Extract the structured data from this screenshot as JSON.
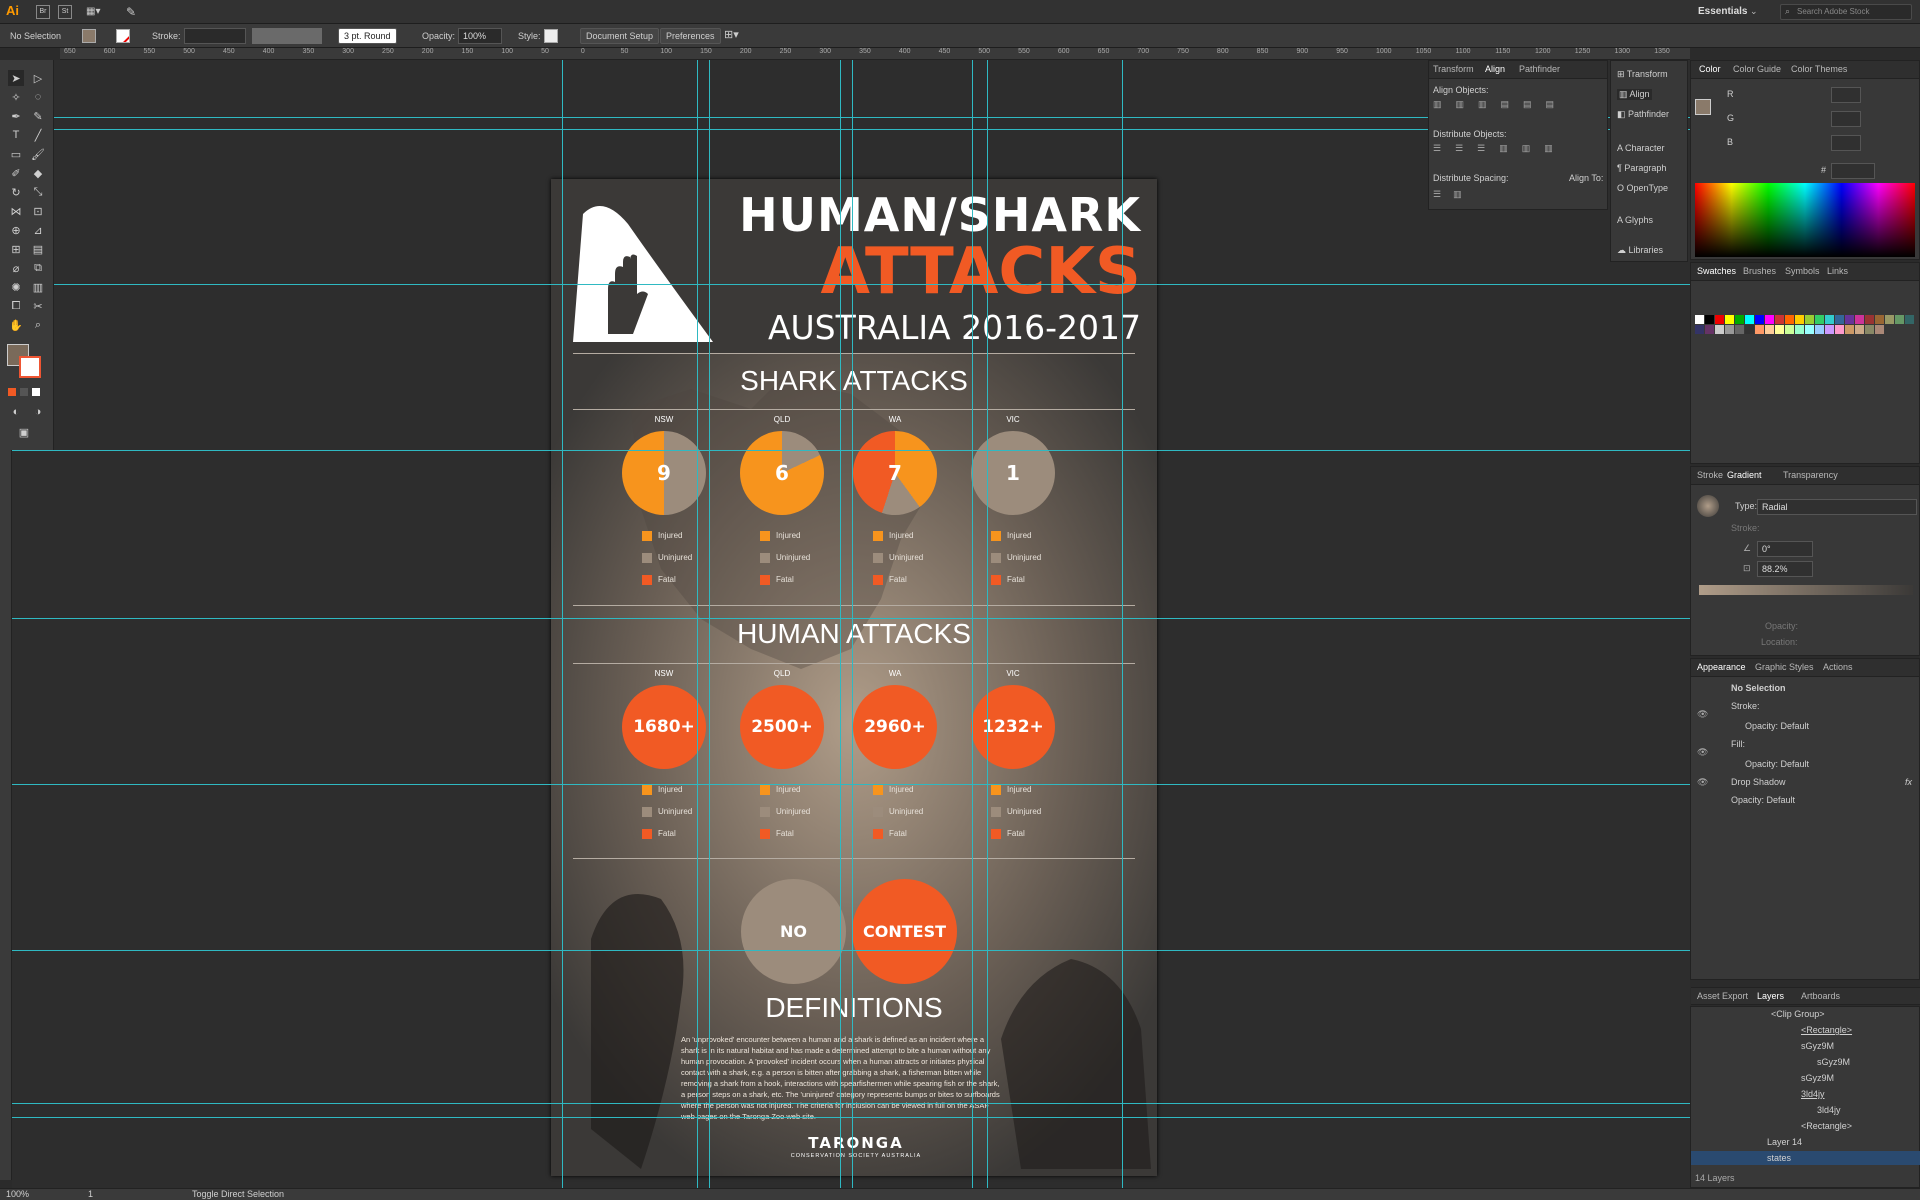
{
  "app": {
    "logo": "Ai",
    "workspace": "Essentials",
    "stock_search_placeholder": "Search Adobe Stock",
    "menu_icons": [
      "bridge-icon",
      "stock-icon",
      "arrange-documents-icon",
      "gpu-performance-icon"
    ]
  },
  "control_bar": {
    "selection": "No Selection",
    "stroke_label": "Stroke:",
    "brush_label": "3 pt. Round",
    "opacity_label": "Opacity:",
    "opacity_value": "100%",
    "style_label": "Style:",
    "document_setup": "Document Setup",
    "preferences": "Preferences"
  },
  "ruler_top": [
    "650",
    "600",
    "550",
    "500",
    "450",
    "400",
    "350",
    "300",
    "250",
    "200",
    "150",
    "100",
    "50",
    "0",
    "50",
    "100",
    "150",
    "200",
    "250",
    "300",
    "350",
    "400",
    "450",
    "500",
    "550",
    "600",
    "650",
    "700",
    "750",
    "800",
    "850",
    "900",
    "950",
    "1000",
    "1050",
    "1100",
    "1150",
    "1200",
    "1250",
    "1300",
    "1350"
  ],
  "infographic": {
    "title_line1": "HUMAN/SHARK",
    "title_line2": "ATTACKS",
    "title_line3": "AUSTRALIA 2016-2017",
    "section1": "SHARK ATTACKS",
    "section2": "HUMAN ATTACKS",
    "states": [
      "NSW",
      "QLD",
      "WA",
      "VIC"
    ],
    "shark_values": [
      "9",
      "6",
      "7",
      "1"
    ],
    "human_values": [
      "1680+",
      "2500+",
      "2960+",
      "1232+"
    ],
    "legend": [
      "Injured",
      "Uninjured",
      "Fatal"
    ],
    "colors": {
      "injured": "#f7941d",
      "uninjured": "#9c8c7c",
      "fatal": "#f15a24",
      "bg": "#3b3937"
    },
    "no_label": "NO",
    "contest_label": "CONTEST",
    "definitions_title": "DEFINITIONS",
    "definitions_text": "An 'unprovoked' encounter between a human and a shark is defined as an incident where a shark is in its natural habitat and has made a determined attempt to bite a human without any human provocation. A 'provoked' incident occurs when a human attracts or initiates physical contact with a shark, e.g. a person is bitten after grabbing a shark, a fisherman bitten while removing a shark from a hook, interactions with spearfishermen while spearing fish or the shark, a person steps on a shark, etc. The 'uninjured' category represents bumps or bites to surfboards where the person was not injured. The criteria for inclusion can be viewed in full on the ASAF web pages on the Taronga Zoo web site.",
    "logo_text": "TARONGA",
    "logo_sub": "CONSERVATION SOCIETY AUSTRALIA"
  },
  "align_panel": {
    "tabs": [
      "Transform",
      "Align",
      "Pathfinder"
    ],
    "align_objects": "Align Objects:",
    "distribute_objects": "Distribute Objects:",
    "distribute_spacing": "Distribute Spacing:",
    "align_to": "Align To:"
  },
  "dock": [
    "Transform",
    "Align",
    "Pathfinder",
    "Character",
    "Paragraph",
    "OpenType",
    "Glyphs",
    "Libraries"
  ],
  "color_panel": {
    "tabs": [
      "Color",
      "Color Guide",
      "Color Themes"
    ],
    "channels": [
      "R",
      "G",
      "B"
    ],
    "hex_label": "#"
  },
  "swatches_panel": {
    "tabs": [
      "Swatches",
      "Brushes",
      "Symbols",
      "Links"
    ]
  },
  "gradient_panel": {
    "tabs": [
      "Stroke",
      "Gradient",
      "Transparency"
    ],
    "type_label": "Type:",
    "type_value": "Radial",
    "stroke_label": "Stroke:",
    "angle_value": "0°",
    "aspect_value": "88.2%",
    "opacity_label": "Opacity:",
    "location_label": "Location:"
  },
  "appearance_panel": {
    "tabs": [
      "Appearance",
      "Graphic Styles",
      "Actions"
    ],
    "rows": [
      "No Selection",
      "Stroke:",
      "Opacity: Default",
      "Fill:",
      "Opacity: Default",
      "Drop Shadow",
      "Opacity: Default"
    ],
    "fx": "fx"
  },
  "layers_panel": {
    "tabs": [
      "Asset Export",
      "Layers",
      "Artboards"
    ],
    "rows": [
      "<Clip Group>",
      "<Rectangle>",
      "sGyz9M",
      "sGyz9M",
      "sGyz9M",
      "3ld4jy",
      "3ld4jy",
      "<Rectangle>",
      "Layer 14",
      "states"
    ],
    "count": "14 Layers"
  },
  "status": {
    "zoom": "100%",
    "artboard": "1",
    "tool": "Toggle Direct Selection"
  }
}
